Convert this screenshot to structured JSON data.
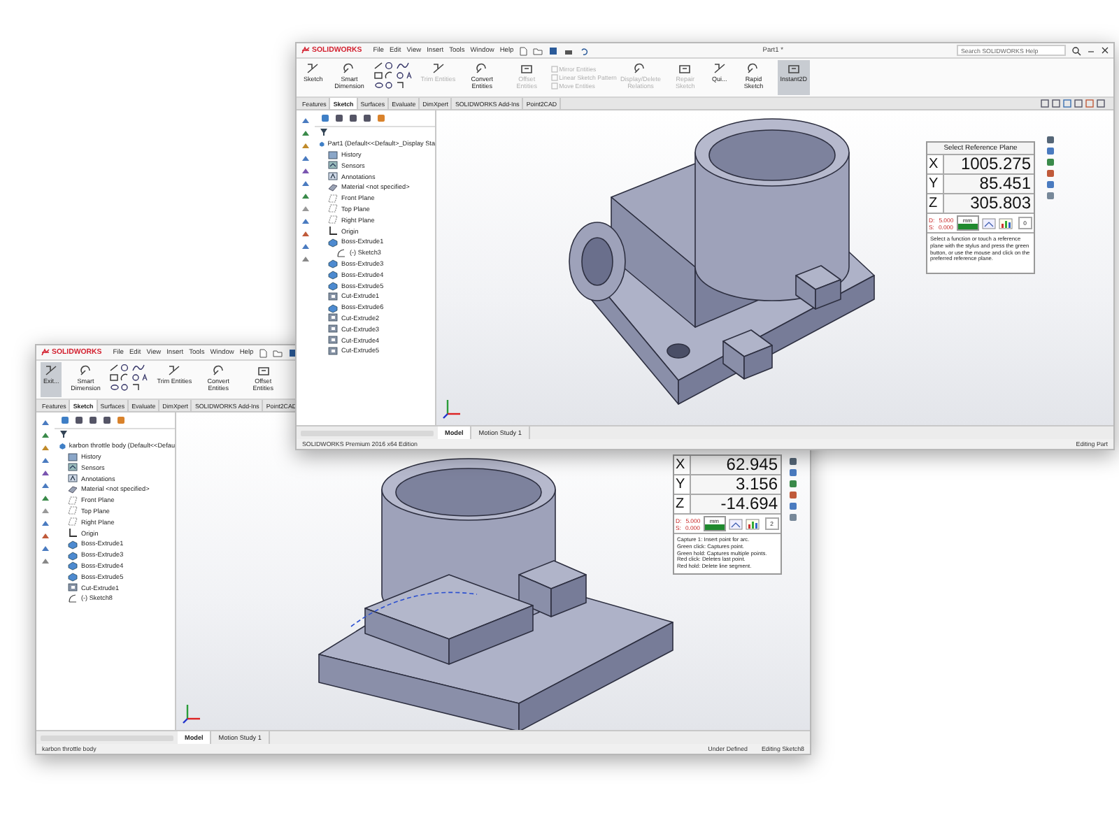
{
  "top_window": {
    "app_name": "SOLIDWORKS",
    "menu": [
      "File",
      "Edit",
      "View",
      "Insert",
      "Tools",
      "Window",
      "Help"
    ],
    "document_title": "Part1 *",
    "search": {
      "placeholder": "Search SOLIDWORKS Help"
    },
    "ribbon": [
      {
        "kind": "large",
        "label": "Sketch",
        "disabled": false,
        "selected": false
      },
      {
        "kind": "large",
        "label": "Smart Dimension",
        "disabled": false,
        "selected": false
      },
      {
        "kind": "sketch_tools"
      },
      {
        "kind": "large",
        "label": "Trim Entities",
        "disabled": true,
        "selected": false
      },
      {
        "kind": "large",
        "label": "Convert Entities",
        "disabled": false,
        "selected": false
      },
      {
        "kind": "large",
        "label": "Offset Entities",
        "disabled": true,
        "selected": false
      },
      {
        "kind": "stack",
        "items": [
          {
            "label": "Mirror Entities",
            "disabled": true
          },
          {
            "label": "Linear Sketch Pattern",
            "disabled": true
          },
          {
            "label": "Move Entities",
            "disabled": true
          }
        ]
      },
      {
        "kind": "large",
        "label": "Display/Delete Relations",
        "disabled": true,
        "selected": false
      },
      {
        "kind": "large",
        "label": "Repair Sketch",
        "disabled": true,
        "selected": false
      },
      {
        "kind": "large",
        "label": "Qui...",
        "disabled": false,
        "selected": false
      },
      {
        "kind": "large",
        "label": "Rapid Sketch",
        "disabled": false,
        "selected": false
      },
      {
        "kind": "large",
        "label": "Instant2D",
        "disabled": false,
        "selected": true
      }
    ],
    "tabs": [
      {
        "label": "Features",
        "selected": false
      },
      {
        "label": "Sketch",
        "selected": true
      },
      {
        "label": "Surfaces",
        "selected": false
      },
      {
        "label": "Evaluate",
        "selected": false
      },
      {
        "label": "DimXpert",
        "selected": false
      },
      {
        "label": "SOLIDWORKS Add-Ins",
        "selected": false
      },
      {
        "label": "Point2CAD",
        "selected": false
      }
    ],
    "tree": {
      "label": "Part1  (Default<<Default>_Display Sta",
      "kind": "part",
      "children": [
        {
          "label": "History",
          "kind": "folder"
        },
        {
          "label": "Sensors",
          "kind": "sensor"
        },
        {
          "label": "Annotations",
          "kind": "annotation"
        },
        {
          "label": "Material <not specified>",
          "kind": "material"
        },
        {
          "label": "Front Plane",
          "kind": "plane"
        },
        {
          "label": "Top Plane",
          "kind": "plane"
        },
        {
          "label": "Right Plane",
          "kind": "plane"
        },
        {
          "label": "Origin",
          "kind": "origin"
        },
        {
          "label": "Boss-Extrude1",
          "kind": "boss",
          "children": [
            {
              "label": "(-) Sketch3",
              "kind": "sketch"
            }
          ]
        },
        {
          "label": "Boss-Extrude3",
          "kind": "boss"
        },
        {
          "label": "Boss-Extrude4",
          "kind": "boss"
        },
        {
          "label": "Boss-Extrude5",
          "kind": "boss"
        },
        {
          "label": "Cut-Extrude1",
          "kind": "cut"
        },
        {
          "label": "Boss-Extrude6",
          "kind": "boss"
        },
        {
          "label": "Cut-Extrude2",
          "kind": "cut"
        },
        {
          "label": "Cut-Extrude3",
          "kind": "cut"
        },
        {
          "label": "Cut-Extrude4",
          "kind": "cut"
        },
        {
          "label": "Cut-Extrude5",
          "kind": "cut"
        }
      ]
    },
    "coordinates": {
      "title": "Select Reference Plane",
      "axes": [
        {
          "axis": "X",
          "value": "1005.275"
        },
        {
          "axis": "Y",
          "value": "85.451"
        },
        {
          "axis": "Z",
          "value": "305.803"
        }
      ],
      "d": "D:",
      "d_value": "5.000",
      "s": "S:",
      "s_value": "0.000",
      "unit": "mm",
      "count": "0",
      "help": [
        "Select a function or touch a reference plane with the stylus and press the green button, or use the mouse and click on the preferred reference plane."
      ]
    },
    "bottom_tabs": [
      {
        "label": "Model",
        "selected": true
      },
      {
        "label": "Motion Study 1",
        "selected": false
      }
    ],
    "status_bar": {
      "left": "SOLIDWORKS Premium 2016 x64 Edition",
      "right": [
        "Editing Part"
      ]
    }
  },
  "bottom_window": {
    "app_name": "SOLIDWORKS",
    "menu": [
      "File",
      "Edit",
      "View",
      "Insert",
      "Tools",
      "Window",
      "Help"
    ],
    "ribbon": [
      {
        "kind": "large",
        "label": "Exit...",
        "disabled": false,
        "selected": true
      },
      {
        "kind": "large",
        "label": "Smart Dimension",
        "disabled": false,
        "selected": false
      },
      {
        "kind": "sketch_tools"
      },
      {
        "kind": "large",
        "label": "Trim Entities",
        "disabled": false,
        "selected": false
      },
      {
        "kind": "large",
        "label": "Convert Entities",
        "disabled": false,
        "selected": false
      },
      {
        "kind": "large",
        "label": "Offset Entities",
        "disabled": false,
        "selected": false
      }
    ],
    "tabs": [
      {
        "label": "Features",
        "selected": false
      },
      {
        "label": "Sketch",
        "selected": true
      },
      {
        "label": "Surfaces",
        "selected": false
      },
      {
        "label": "Evaluate",
        "selected": false
      },
      {
        "label": "DimXpert",
        "selected": false
      },
      {
        "label": "SOLIDWORKS Add-Ins",
        "selected": false
      },
      {
        "label": "Point2CAD",
        "selected": false
      }
    ],
    "tree": {
      "label": "karbon throttle body  (Default<<Defau",
      "kind": "part",
      "children": [
        {
          "label": "History",
          "kind": "folder"
        },
        {
          "label": "Sensors",
          "kind": "sensor"
        },
        {
          "label": "Annotations",
          "kind": "annotation"
        },
        {
          "label": "Material <not specified>",
          "kind": "material"
        },
        {
          "label": "Front Plane",
          "kind": "plane"
        },
        {
          "label": "Top Plane",
          "kind": "plane"
        },
        {
          "label": "Right Plane",
          "kind": "plane"
        },
        {
          "label": "Origin",
          "kind": "origin"
        },
        {
          "label": "Boss-Extrude1",
          "kind": "boss"
        },
        {
          "label": "Boss-Extrude3",
          "kind": "boss"
        },
        {
          "label": "Boss-Extrude4",
          "kind": "boss"
        },
        {
          "label": "Boss-Extrude5",
          "kind": "boss"
        },
        {
          "label": "Cut-Extrude1",
          "kind": "cut"
        },
        {
          "label": "(-) Sketch8",
          "kind": "sketch"
        }
      ]
    },
    "coordinates": {
      "axes": [
        {
          "axis": "X",
          "value": "62.945"
        },
        {
          "axis": "Y",
          "value": "3.156"
        },
        {
          "axis": "Z",
          "value": "-14.694"
        }
      ],
      "d": "D:",
      "d_value": "5.000",
      "s": "S:",
      "s_value": "0.000",
      "unit": "mm",
      "count": "2",
      "help": [
        "Capture 1: Insert point for arc.",
        "Green click: Captures point.",
        "Green hold: Captures multiple points.",
        "Red click: Deletes last point.",
        "Red hold: Delete line segment."
      ]
    },
    "bottom_tabs": [
      {
        "label": "Model",
        "selected": true
      },
      {
        "label": "Motion Study 1",
        "selected": false
      }
    ],
    "status_bar": {
      "left": "karbon throttle body",
      "right": [
        "Under Defined",
        "Editing Sketch8"
      ]
    }
  }
}
